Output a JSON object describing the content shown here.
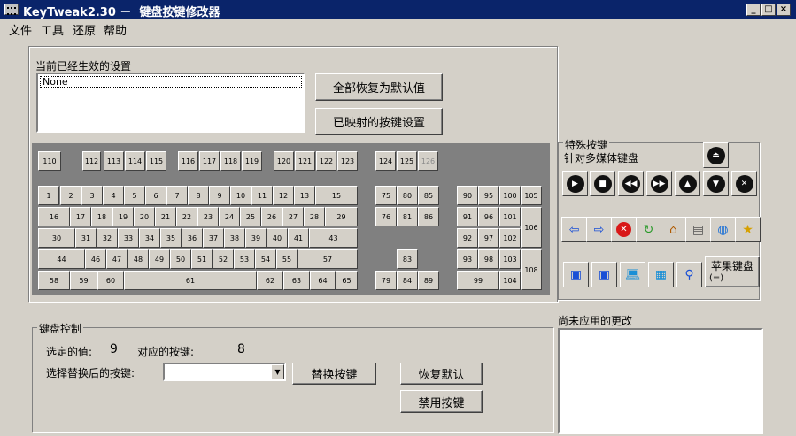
{
  "window": {
    "title": "KeyTweak2.30 －  键盘按键修改器",
    "min": "_",
    "max": "□",
    "close": "×"
  },
  "menu": [
    "文件",
    "工具",
    "还原",
    "帮助"
  ],
  "current_settings": {
    "label": "当前已经生效的设置",
    "items": [
      "None"
    ]
  },
  "buttons": {
    "restore_all": "全部恢复为默认值",
    "mapped_keys": "已映射的按键设置",
    "replace": "替换按键",
    "restore_default": "恢复默认",
    "disable": "禁用按键"
  },
  "keyboard": {
    "keys": [
      "110",
      "112",
      "113",
      "114",
      "115",
      "116",
      "117",
      "118",
      "119",
      "120",
      "121",
      "122",
      "123",
      "124",
      "125",
      "126",
      "1",
      "2",
      "3",
      "4",
      "5",
      "6",
      "7",
      "8",
      "9",
      "10",
      "11",
      "12",
      "13",
      "15",
      "75",
      "80",
      "85",
      "90",
      "95",
      "100",
      "105",
      "16",
      "17",
      "18",
      "19",
      "20",
      "21",
      "22",
      "23",
      "24",
      "25",
      "26",
      "27",
      "28",
      "29",
      "76",
      "81",
      "86",
      "91",
      "96",
      "101",
      "106",
      "30",
      "31",
      "32",
      "33",
      "34",
      "35",
      "36",
      "37",
      "38",
      "39",
      "40",
      "41",
      "43",
      "92",
      "97",
      "102",
      "44",
      "46",
      "47",
      "48",
      "49",
      "50",
      "51",
      "52",
      "53",
      "54",
      "55",
      "57",
      "83",
      "93",
      "98",
      "103",
      "108",
      "58",
      "59",
      "60",
      "61",
      "62",
      "63",
      "64",
      "65",
      "79",
      "84",
      "89",
      "99",
      "104"
    ]
  },
  "special": {
    "title": "特殊按键",
    "subtitle": "针对多媒体键盘",
    "apple": "苹果键盘",
    "apple_sub": "(=)"
  },
  "control": {
    "title": "键盘控制",
    "selected_label": "选定的值:",
    "selected_value": "9",
    "mapped_label": "对应的按键:",
    "mapped_value": "8",
    "choose_label": "选择替换后的按键:",
    "combo_value": ""
  },
  "pending": {
    "title": "尚未应用的更改"
  }
}
